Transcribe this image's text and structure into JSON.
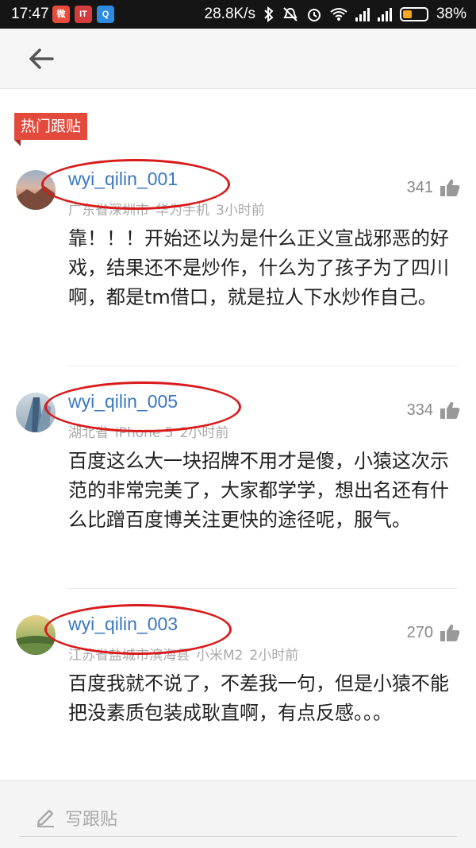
{
  "status_bar": {
    "time": "17:47",
    "app_icons": [
      {
        "name": "weibo-icon",
        "color": "#e94b3c",
        "glyph": "微"
      },
      {
        "name": "toutiao-icon",
        "color": "#d43d3d",
        "glyph": "IT"
      },
      {
        "name": "browser-icon",
        "color": "#2d8ce0",
        "glyph": "Q"
      }
    ],
    "net_speed": "28.8K/s",
    "battery": "38%",
    "battery_level": 0.38
  },
  "header": {
    "back_icon": "back-arrow-icon"
  },
  "section": {
    "label": "热门跟贴"
  },
  "comments": [
    {
      "username": "wyi_qilin_001",
      "location": "广东省深圳市",
      "device": "华为手机",
      "time": "3小时前",
      "likes": "341",
      "text": "靠！！！开始还以为是什么正义宣战邪恶的好戏，结果还不是炒作，什么为了孩子为了四川啊，都是tm借口，就是拉人下水炒作自己。",
      "avatar": "sunset-avatar"
    },
    {
      "username": "wyi_qilin_005",
      "location": "湖北省",
      "device": "iPhone 5",
      "time": "2小时前",
      "likes": "334",
      "text": "百度这么大一块招牌不用才是傻，小猿这次示范的非常完美了，大家都学学，想出名还有什么比蹭百度博关注更快的途径呢，服气。",
      "avatar": "building-avatar"
    },
    {
      "username": "wyi_qilin_003",
      "location": "江苏省盐城市滨海县",
      "device": "小米M2",
      "time": "2小时前",
      "likes": "270",
      "text": "百度我就不说了，不差我一句，但是小猿不能把没素质包装成耿直啊，有点反感。。。",
      "avatar": "landscape-avatar"
    }
  ],
  "footer": {
    "write_label": "写跟贴",
    "write_icon": "pencil-icon"
  },
  "colors": {
    "accent_red": "#e44a3c",
    "username_blue": "#3a77c1",
    "annotation_red": "#d91a1a"
  }
}
